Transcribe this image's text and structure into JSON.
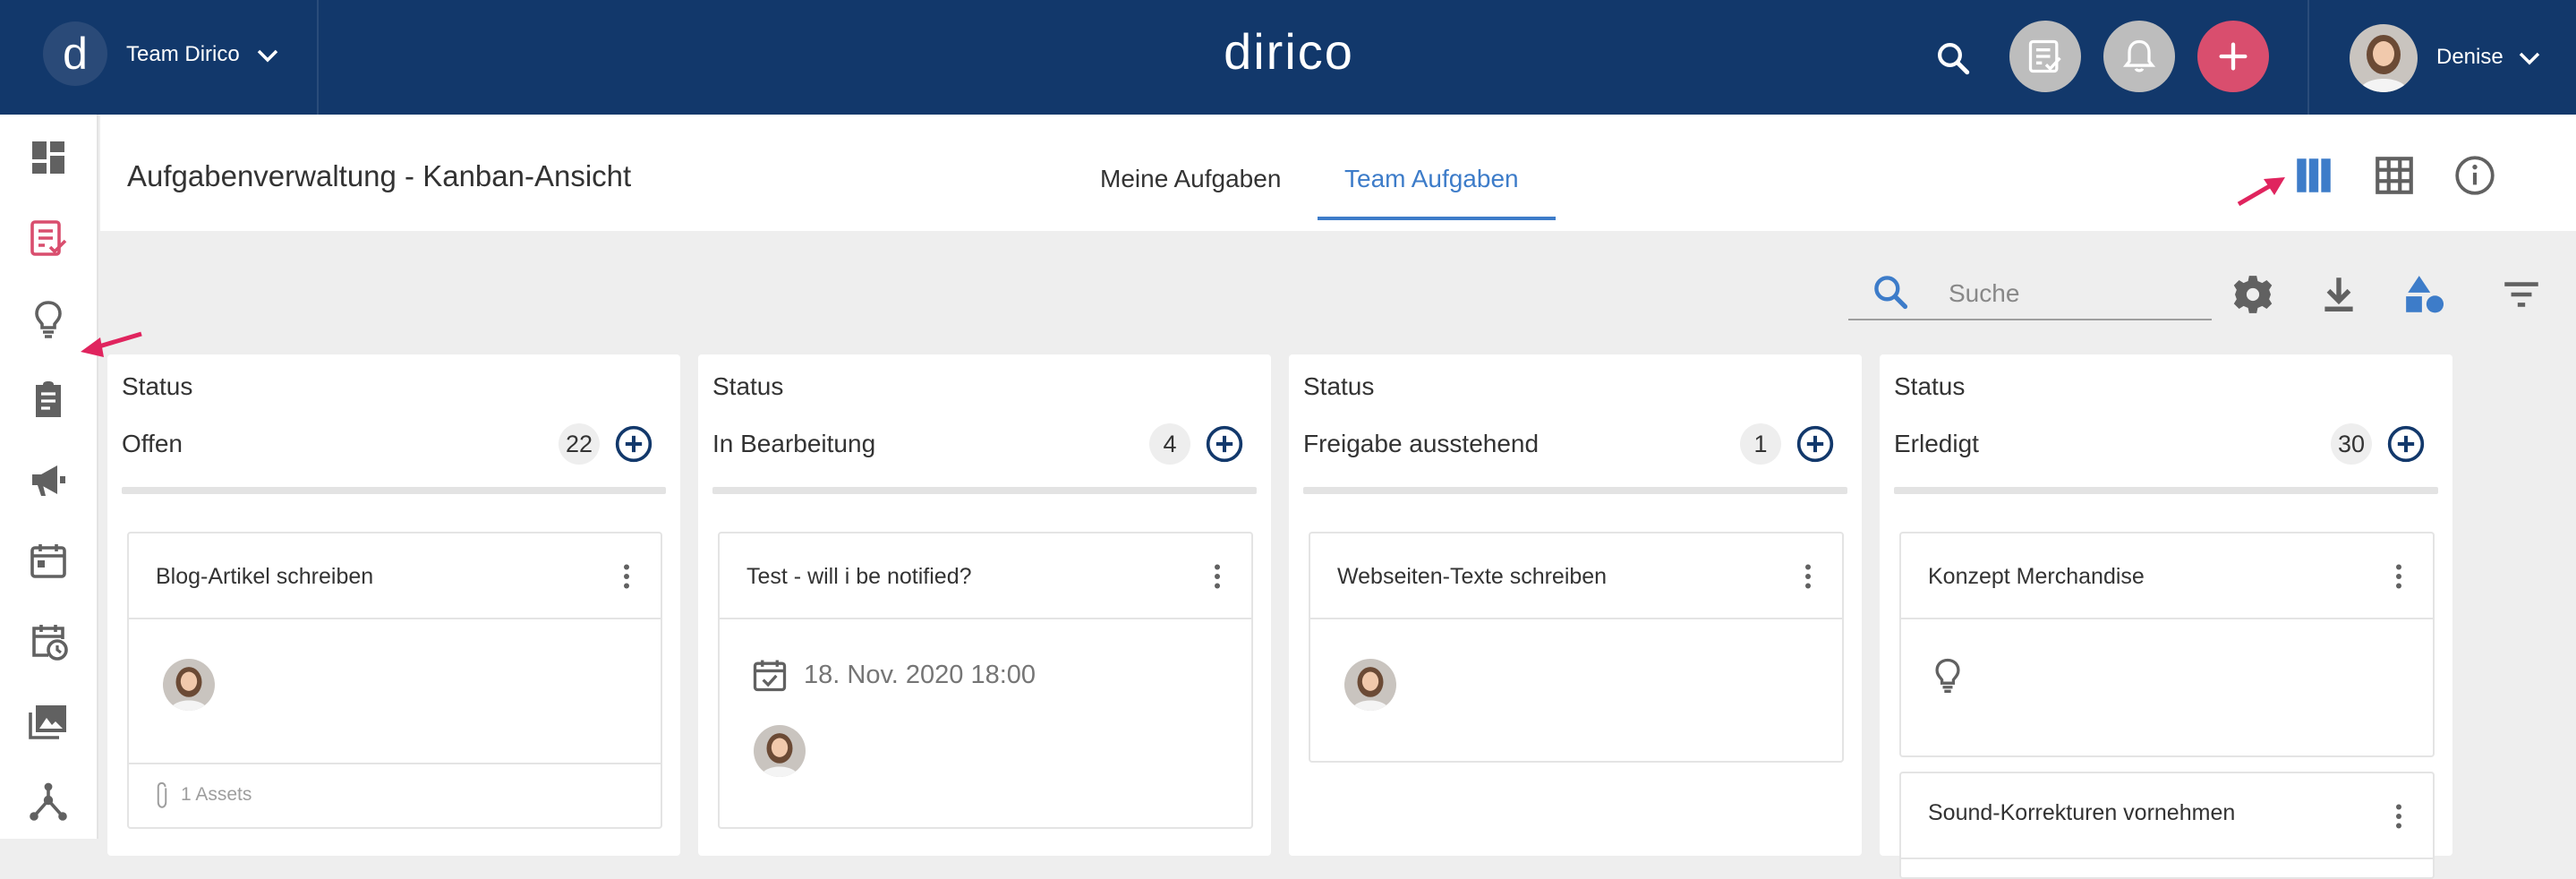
{
  "topbar": {
    "logo_letter": "d",
    "team_label": "Team Dirico",
    "brand": "dirico",
    "user_name": "Denise"
  },
  "header": {
    "title": "Aufgabenverwaltung - Kanban-Ansicht",
    "tabs": [
      {
        "label": "Meine Aufgaben",
        "active": false
      },
      {
        "label": "Team Aufgaben",
        "active": true
      }
    ]
  },
  "toolbar": {
    "search_placeholder": "Suche"
  },
  "sidebar": {
    "items": [
      {
        "icon": "dashboard-icon"
      },
      {
        "icon": "tasks-icon",
        "active": true
      },
      {
        "icon": "lightbulb-icon"
      },
      {
        "icon": "clipboard-icon"
      },
      {
        "icon": "megaphone-icon"
      },
      {
        "icon": "calendar-icon"
      },
      {
        "icon": "calendar-clock-icon"
      },
      {
        "icon": "media-icon"
      },
      {
        "icon": "network-icon"
      }
    ]
  },
  "columns": [
    {
      "status_label": "Status",
      "name": "Offen",
      "count": "22",
      "cards": [
        {
          "title": "Blog-Artikel schreiben",
          "assets": "1 Assets"
        }
      ]
    },
    {
      "status_label": "Status",
      "name": "In Bearbeitung",
      "count": "4",
      "cards": [
        {
          "title": "Test - will i be notified?",
          "date": "18. Nov. 2020 18:00"
        }
      ]
    },
    {
      "status_label": "Status",
      "name": "Freigabe ausstehend",
      "count": "1",
      "cards": [
        {
          "title": "Webseiten-Texte schreiben"
        }
      ]
    },
    {
      "status_label": "Status",
      "name": "Erledigt",
      "count": "30",
      "cards": [
        {
          "title": "Konzept Merchandise"
        },
        {
          "title": "Sound-Korrekturen vornehmen"
        }
      ]
    }
  ],
  "colors": {
    "topbar_bg": "#12386b",
    "accent_blue": "#3d7cc9",
    "accent_pink": "#d94e6e",
    "icon_gray": "#616161"
  }
}
